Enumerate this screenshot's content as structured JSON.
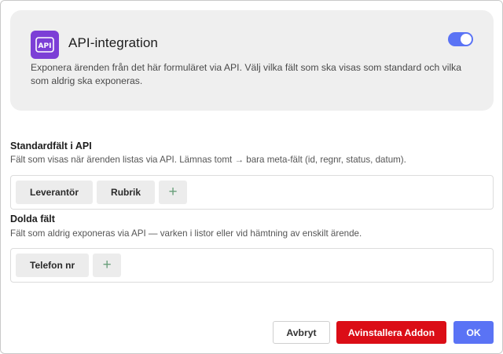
{
  "addon": {
    "title": "API-integration",
    "icon": "api-icon",
    "icon_label": "API",
    "enabled": true,
    "description": "Exponera ärenden från det här formuläret via API. Välj vilka fält som ska visas som standard och vilka som aldrig ska exponeras."
  },
  "standard_fields": {
    "title": "Standardfält i API",
    "description": "Fält som visas när ärenden listas via API. Lämnas tomt → bara meta-fält (id, regnr, status, datum).",
    "chips": [
      "Leverantör",
      "Rubrik"
    ],
    "add_label": "+"
  },
  "hidden_fields": {
    "title": "Dolda fält",
    "description": "Fält som aldrig exponeras via API — varken i listor eller vid hämtning av enskilt ärende.",
    "chips": [
      "Telefon nr"
    ],
    "add_label": "+"
  },
  "footer": {
    "cancel_label": "Avbryt",
    "uninstall_label": "Avinstallera Addon",
    "ok_label": "OK"
  },
  "colors": {
    "accent": "#5a73f5",
    "danger": "#db0d16",
    "icon_bg": "#7c3fd6"
  }
}
